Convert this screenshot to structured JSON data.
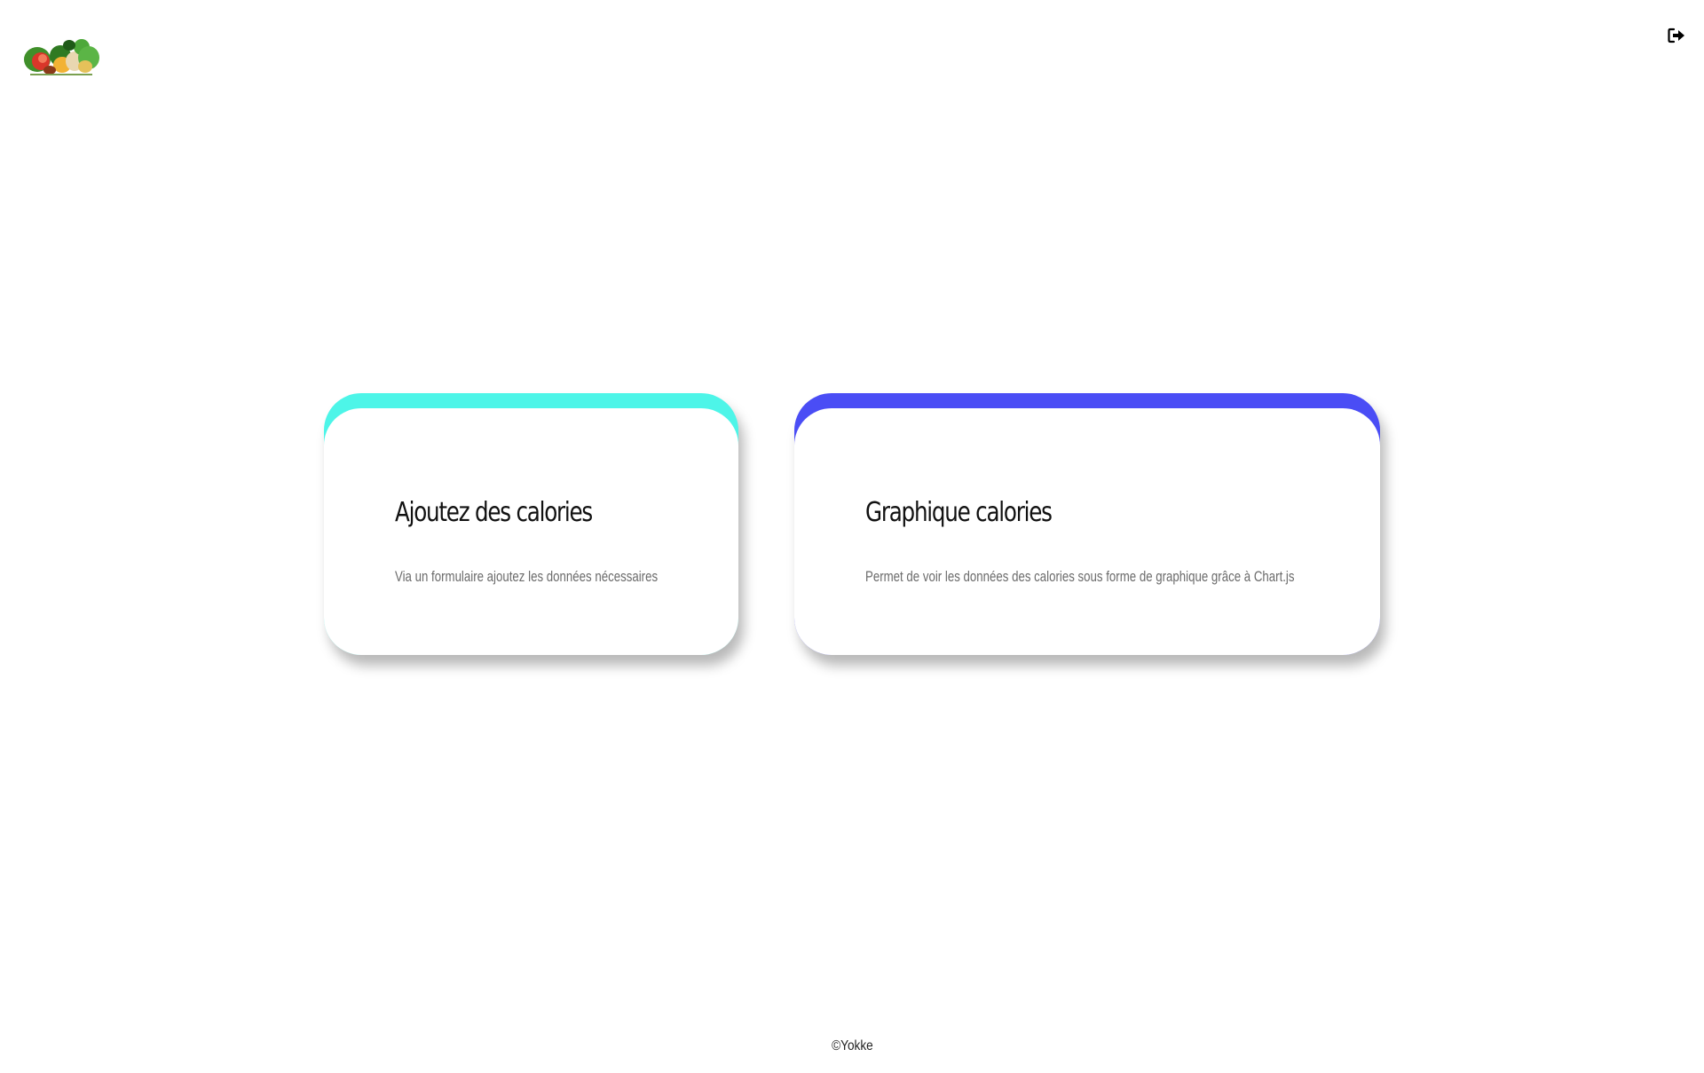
{
  "header": {
    "logo_icon": "vegetables-logo",
    "logout_icon": "sign-out-icon"
  },
  "cards": [
    {
      "title": "Ajoutez des calories",
      "description": "Via un formulaire ajoutez les données nécessaires",
      "accent": "#4df5e8"
    },
    {
      "title": "Graphique calories",
      "description": "Permet de voir les données des calories sous forme de graphique grâce à Chart.js",
      "accent": "#4a4df5"
    }
  ],
  "footer": {
    "copyright": "©Yokke"
  }
}
